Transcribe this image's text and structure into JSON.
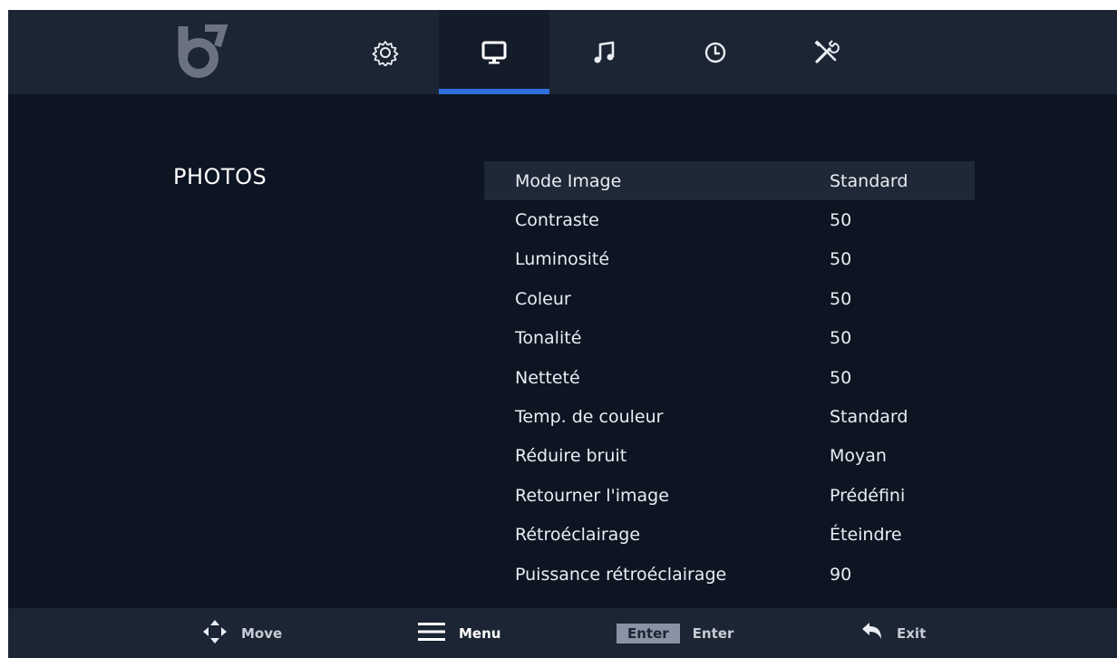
{
  "brand": {
    "logo": "bolt-logo"
  },
  "tabs": [
    {
      "icon": "settings-icon",
      "active": false
    },
    {
      "icon": "display-icon",
      "active": true
    },
    {
      "icon": "music-note-icon",
      "active": false
    },
    {
      "icon": "clock-icon",
      "active": false
    },
    {
      "icon": "tools-icon",
      "active": false
    }
  ],
  "section": {
    "title": "PHOTOS"
  },
  "menu": {
    "selected_index": 0,
    "items": [
      {
        "label": "Mode Image",
        "value": "Standard"
      },
      {
        "label": "Contraste",
        "value": "50"
      },
      {
        "label": "Luminosité",
        "value": "50"
      },
      {
        "label": "Coleur",
        "value": "50"
      },
      {
        "label": "Tonalité",
        "value": "50"
      },
      {
        "label": "Netteté",
        "value": "50"
      },
      {
        "label": "Temp. de couleur",
        "value": "Standard"
      },
      {
        "label": "Réduire bruit",
        "value": "Moyan"
      },
      {
        "label": "Retourner l'image",
        "value": "Prédéfini"
      },
      {
        "label": "Rétroéclairage",
        "value": "Éteindre"
      },
      {
        "label": "Puissance rétroéclairage",
        "value": "90"
      }
    ]
  },
  "footer": {
    "move": {
      "icon": "dpad-icon",
      "label": "Move"
    },
    "menu": {
      "icon": "menu-icon",
      "label": "Menu"
    },
    "enter": {
      "key": "Enter",
      "label": "Enter"
    },
    "exit": {
      "icon": "back-arrow-icon",
      "label": "Exit"
    }
  },
  "colors": {
    "background": "#0d1422",
    "bar": "#1c2533",
    "accent": "#2e6fdc",
    "selected_row": "#1e2836"
  }
}
